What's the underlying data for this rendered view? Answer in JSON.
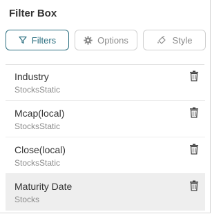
{
  "panel": {
    "title": "Filter Box"
  },
  "tabs": [
    {
      "label": "Filters",
      "icon": "filter-icon",
      "active": true
    },
    {
      "label": "Options",
      "icon": "gear-icon",
      "active": false
    },
    {
      "label": "Style",
      "icon": "paint-icon",
      "active": false
    }
  ],
  "filters": [
    {
      "name": "Industry",
      "source": "StocksStatic",
      "selected": false
    },
    {
      "name": "Mcap(local)",
      "source": "StocksStatic",
      "selected": false
    },
    {
      "name": "Close(local)",
      "source": "StocksStatic",
      "selected": false
    },
    {
      "name": "Maturity Date",
      "source": "Stocks",
      "selected": true
    }
  ],
  "colors": {
    "accent": "#2b6f80",
    "selected_row": "#eeeeee"
  }
}
